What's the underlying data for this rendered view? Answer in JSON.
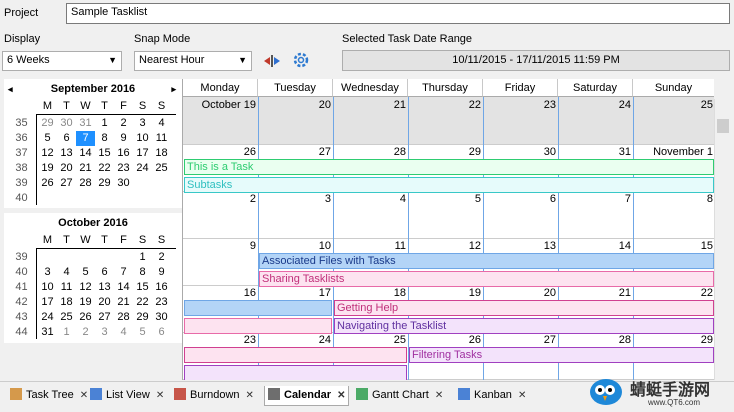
{
  "project": {
    "label": "Project",
    "value": "Sample Tasklist"
  },
  "display": {
    "label": "Display",
    "value": "6 Weeks"
  },
  "snap": {
    "label": "Snap Mode",
    "value": "Nearest Hour"
  },
  "range": {
    "label": "Selected Task Date Range",
    "value": "10/11/2015 - 17/11/2015 11:59 PM"
  },
  "icons": {
    "filter": "red-blue-arrows-icon",
    "settings": "gear-icon"
  },
  "minicals": [
    {
      "title": "September 2016",
      "nav_prev": "◂",
      "nav_next": "▸",
      "weekdays": [
        "M",
        "T",
        "W",
        "T",
        "F",
        "S",
        "S"
      ],
      "weeks": [
        {
          "wk": "35",
          "days": [
            "29",
            "30",
            "31",
            "1",
            "2",
            "3",
            "4"
          ],
          "grey": [
            0,
            1,
            2
          ]
        },
        {
          "wk": "36",
          "days": [
            "5",
            "6",
            "7",
            "8",
            "9",
            "10",
            "11"
          ],
          "grey": [],
          "sel": 2
        },
        {
          "wk": "37",
          "days": [
            "12",
            "13",
            "14",
            "15",
            "16",
            "17",
            "18"
          ],
          "grey": []
        },
        {
          "wk": "38",
          "days": [
            "19",
            "20",
            "21",
            "22",
            "23",
            "24",
            "25"
          ],
          "grey": []
        },
        {
          "wk": "39",
          "days": [
            "26",
            "27",
            "28",
            "29",
            "30",
            "",
            ""
          ],
          "grey": []
        },
        {
          "wk": "40",
          "days": [
            "",
            "",
            "",
            "",
            "",
            "",
            ""
          ],
          "grey": []
        }
      ]
    },
    {
      "title": "October 2016",
      "weekdays": [
        "M",
        "T",
        "W",
        "T",
        "F",
        "S",
        "S"
      ],
      "weeks": [
        {
          "wk": "39",
          "days": [
            "",
            "",
            "",
            "",
            "",
            "1",
            "2"
          ],
          "grey": []
        },
        {
          "wk": "40",
          "days": [
            "3",
            "4",
            "5",
            "6",
            "7",
            "8",
            "9"
          ],
          "grey": []
        },
        {
          "wk": "41",
          "days": [
            "10",
            "11",
            "12",
            "13",
            "14",
            "15",
            "16"
          ],
          "grey": []
        },
        {
          "wk": "42",
          "days": [
            "17",
            "18",
            "19",
            "20",
            "21",
            "22",
            "23"
          ],
          "grey": []
        },
        {
          "wk": "43",
          "days": [
            "24",
            "25",
            "26",
            "27",
            "28",
            "29",
            "30"
          ],
          "grey": []
        },
        {
          "wk": "44",
          "days": [
            "31",
            "1",
            "2",
            "3",
            "4",
            "5",
            "6"
          ],
          "grey": [
            1,
            2,
            3,
            4,
            5,
            6
          ]
        }
      ]
    }
  ],
  "calendar": {
    "days": [
      "Monday",
      "Tuesday",
      "Wednesday",
      "Thursday",
      "Friday",
      "Saturday",
      "Sunday"
    ],
    "weeks": [
      [
        "October 19",
        "20",
        "21",
        "22",
        "23",
        "24",
        "25"
      ],
      [
        "26",
        "27",
        "28",
        "29",
        "30",
        "31",
        "November 1"
      ],
      [
        "2",
        "3",
        "4",
        "5",
        "6",
        "7",
        "8"
      ],
      [
        "9",
        "10",
        "11",
        "12",
        "13",
        "14",
        "15"
      ],
      [
        "16",
        "17",
        "18",
        "19",
        "20",
        "21",
        "22"
      ],
      [
        "23",
        "24",
        "25",
        "26",
        "27",
        "28",
        "29"
      ]
    ],
    "tasks": [
      {
        "label": "This is a Task",
        "week": 1,
        "row": 0,
        "start": 0,
        "end": 7,
        "color": "#2ecc71",
        "bg": "#eafff0",
        "text": "#2ecc71"
      },
      {
        "label": "Subtasks",
        "week": 1,
        "row": 1,
        "start": 0,
        "end": 7,
        "color": "#38c8c8",
        "bg": "#e6fbfb",
        "text": "#30c0c0"
      },
      {
        "label": "Associated Files with Tasks",
        "week": 3,
        "row": 0,
        "start": 1,
        "end": 7,
        "color": "#6fa6e6",
        "bg": "#b3d4f7",
        "text": "#1a3a8a"
      },
      {
        "label": "Sharing Tasklists",
        "week": 3,
        "row": 1,
        "start": 1,
        "end": 7,
        "color": "#e86aa8",
        "bg": "#fde3f0",
        "text": "#c0307a"
      },
      {
        "label": "",
        "week": 4,
        "row": 0,
        "start": 0,
        "end": 2,
        "color": "#6fa6e6",
        "bg": "#b3d4f7",
        "text": "#1a3a8a"
      },
      {
        "label": "Getting Help",
        "week": 4,
        "row": 0,
        "start": 2,
        "end": 7,
        "color": "#d04090",
        "bg": "#fde3f0",
        "text": "#c0307a"
      },
      {
        "label": "",
        "week": 4,
        "row": 1,
        "start": 0,
        "end": 2,
        "color": "#e86aa8",
        "bg": "#fde3f0",
        "text": "#c0307a"
      },
      {
        "label": "Navigating the Tasklist",
        "week": 4,
        "row": 1,
        "start": 2,
        "end": 7,
        "color": "#a040c0",
        "bg": "#f3e3fb",
        "text": "#6030a0"
      },
      {
        "label": "",
        "week": 5,
        "row": 0,
        "start": 0,
        "end": 3,
        "color": "#d04090",
        "bg": "#fde3f0",
        "text": "#c0307a"
      },
      {
        "label": "Filtering Tasks",
        "week": 5,
        "row": 0,
        "start": 3,
        "end": 7,
        "color": "#a040c0",
        "bg": "#f3e3fb",
        "text": "#a030a0"
      },
      {
        "label": "",
        "week": 5,
        "row": 1,
        "start": 0,
        "end": 3,
        "color": "#a040c0",
        "bg": "#f3e3fb",
        "text": "#6030a0"
      }
    ]
  },
  "tabs": [
    {
      "label": "Task Tree",
      "icon": "tree-icon"
    },
    {
      "label": "List View",
      "icon": "list-icon"
    },
    {
      "label": "Burndown",
      "icon": "chart-icon"
    },
    {
      "label": "Calendar",
      "icon": "calendar-icon",
      "active": true
    },
    {
      "label": "Gantt Chart",
      "icon": "gantt-icon"
    },
    {
      "label": "Kanban",
      "icon": "kanban-icon"
    }
  ],
  "watermark": {
    "text": "蜻蜓手游网",
    "url": "www.QT6.com"
  }
}
